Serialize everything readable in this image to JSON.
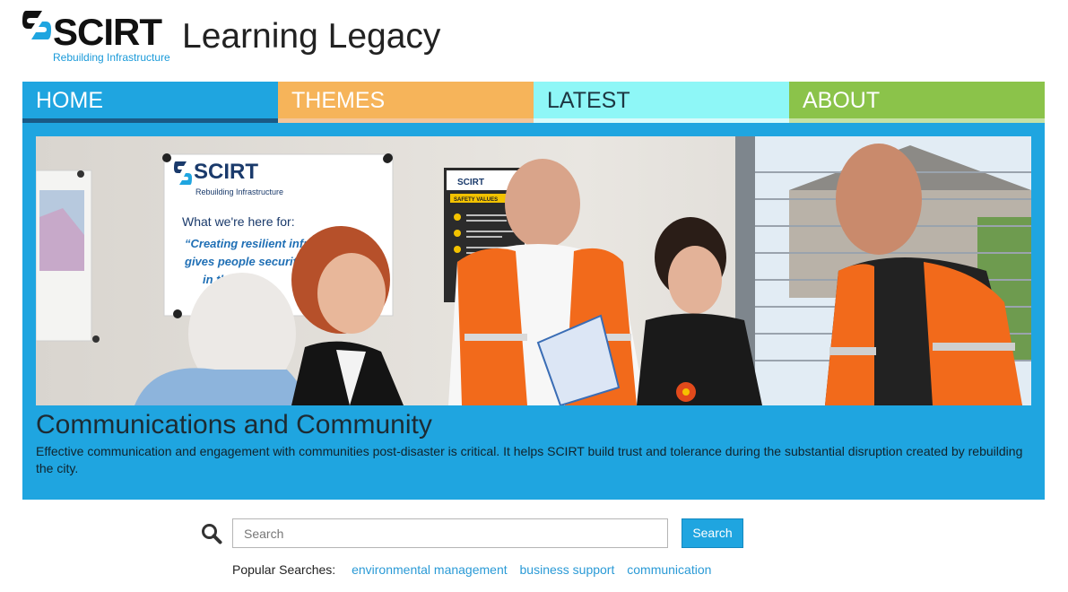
{
  "header": {
    "logo_word": "SCIRT",
    "logo_tagline": "Rebuilding Infrastructure",
    "site_title": "Learning Legacy"
  },
  "nav": {
    "items": [
      {
        "label": "HOME",
        "color": "#1fa5e0"
      },
      {
        "label": "THEMES",
        "color": "#f6b45a"
      },
      {
        "label": "LATEST",
        "color": "#8ef7f7"
      },
      {
        "label": "ABOUT",
        "color": "#8bc34a"
      }
    ]
  },
  "hero": {
    "poster": {
      "logo_word": "SCIRT",
      "logo_tagline": "Rebuilding Infrastructure",
      "heading": "What we're here for:",
      "quote_lines": [
        "“Creating resilient infra",
        "gives people security a",
        "in the f"
      ]
    },
    "board": {
      "logo_word": "SCIRT",
      "heading": "SAFETY VALUES"
    },
    "title": "Communications and Community",
    "description": "Effective communication and engagement with communities post-disaster is critical. It helps SCIRT build trust and tolerance during the substantial disruption created by rebuilding the city."
  },
  "search": {
    "placeholder": "Search",
    "button_label": "Search",
    "popular_label": "Popular Searches:",
    "popular_links": [
      "environmental management",
      "business support",
      "communication"
    ]
  }
}
